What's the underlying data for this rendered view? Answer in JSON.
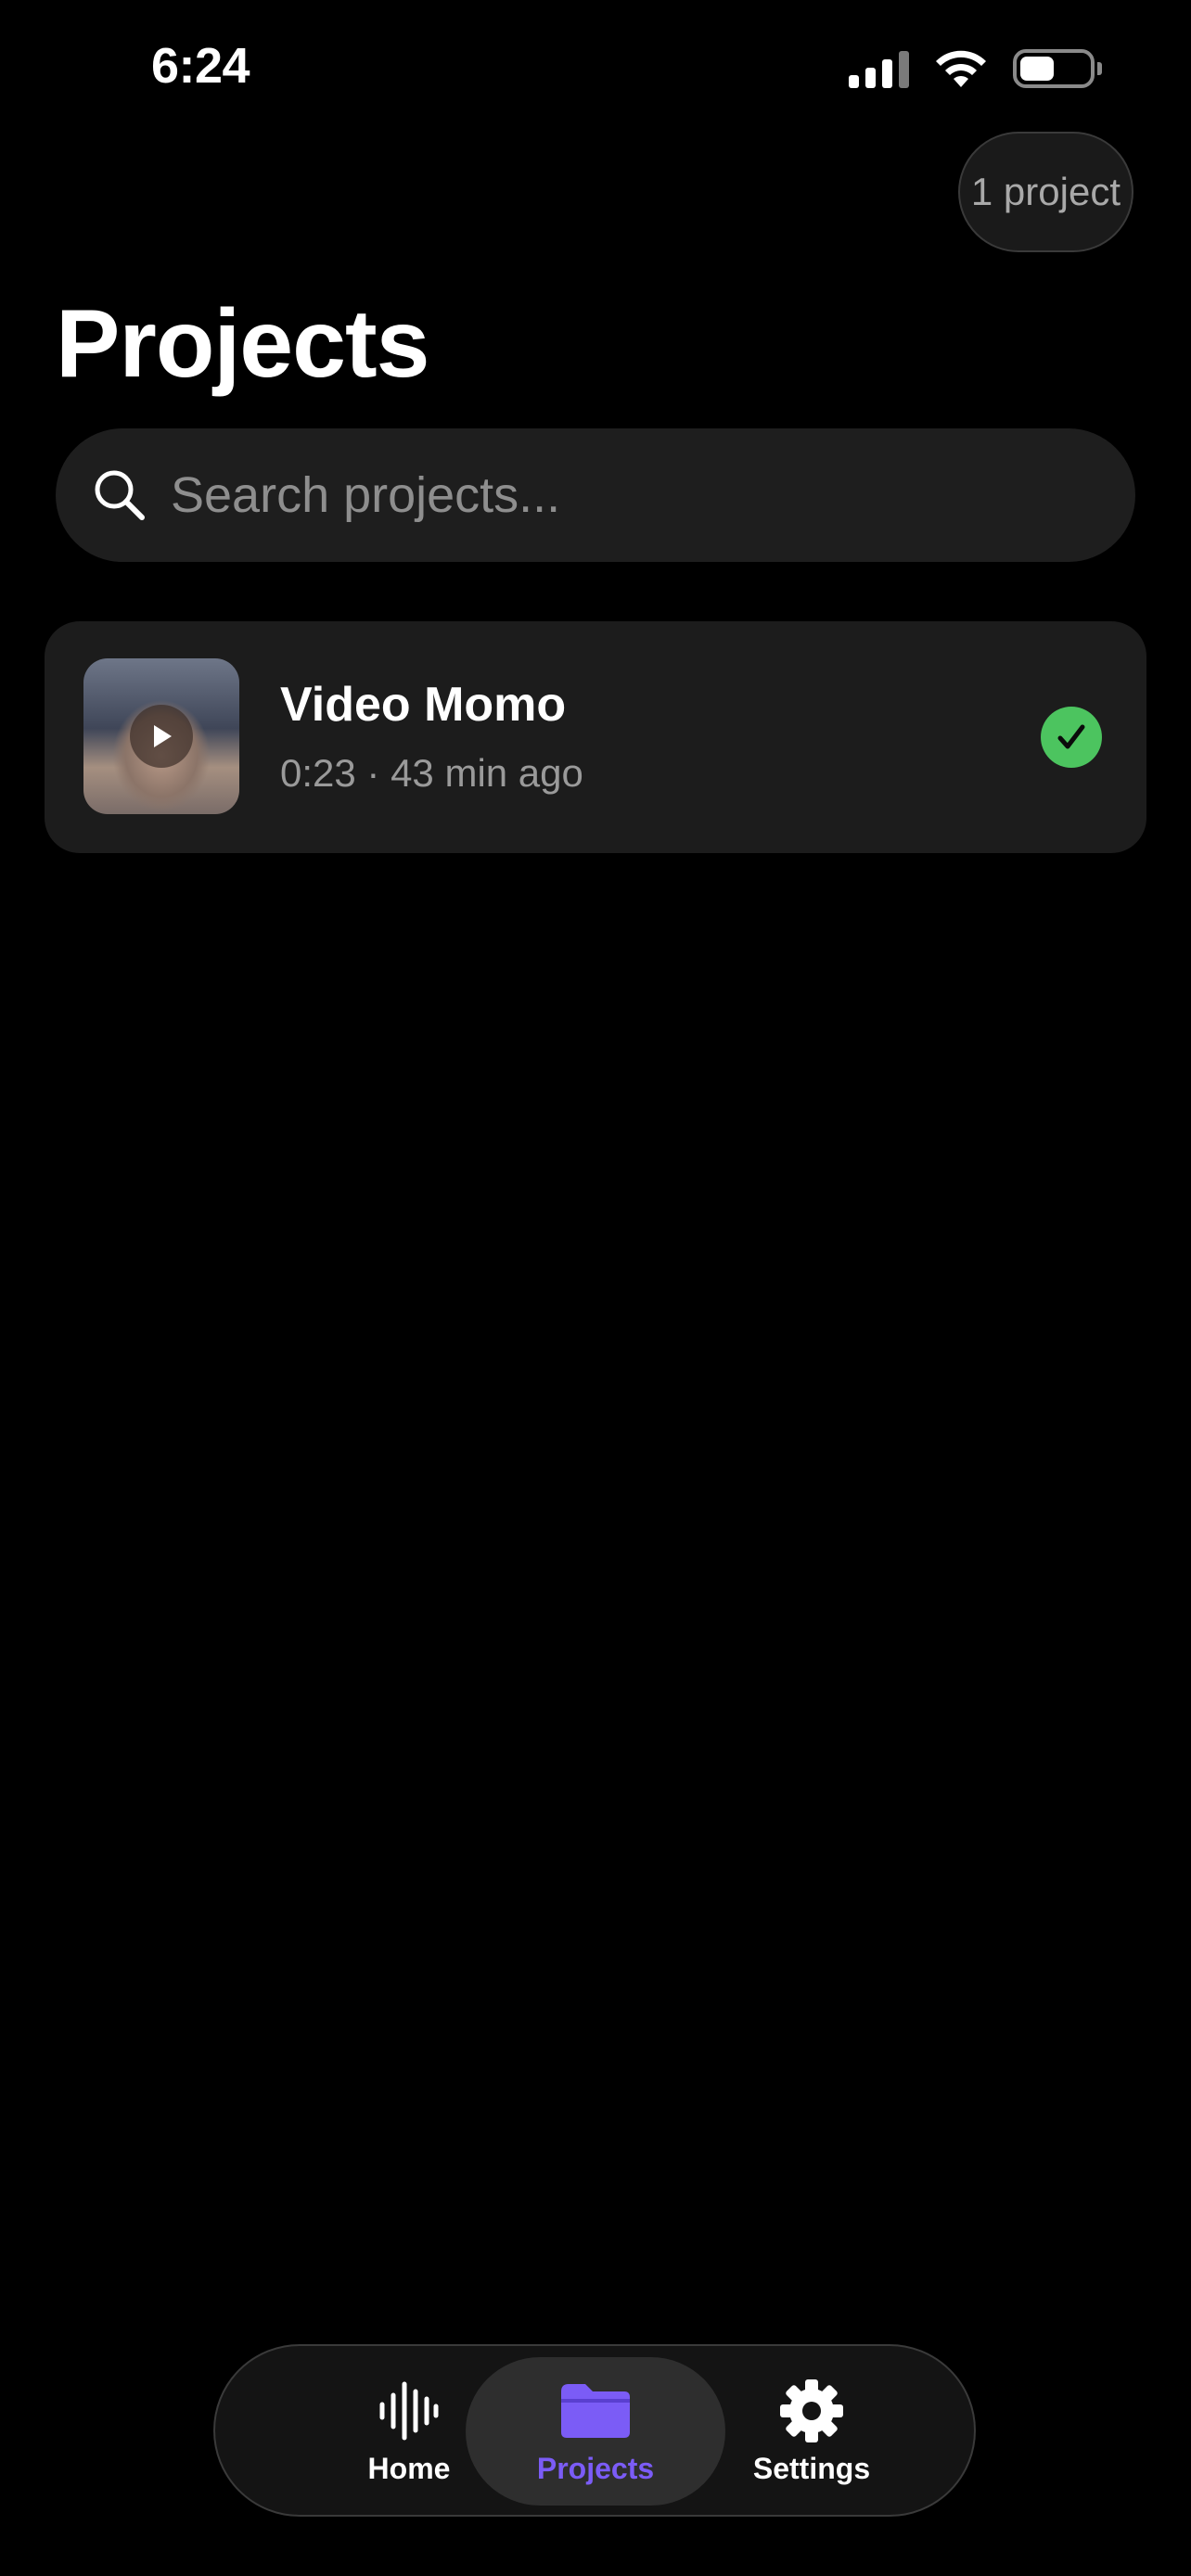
{
  "status_bar": {
    "time": "6:24"
  },
  "header": {
    "count_label": "1 project",
    "title": "Projects"
  },
  "search": {
    "placeholder": "Search projects..."
  },
  "projects": [
    {
      "name": "Video Momo",
      "meta": "0:23 · 43 min ago",
      "status": "done",
      "status_color": "#4cc45f"
    }
  ],
  "tabbar": {
    "tabs": [
      {
        "label": "Home",
        "icon": "waveform-icon",
        "active": false
      },
      {
        "label": "Projects",
        "icon": "folder-icon",
        "active": true
      },
      {
        "label": "Settings",
        "icon": "gear-icon",
        "active": false
      }
    ],
    "active_color": "#7b5cf6"
  }
}
